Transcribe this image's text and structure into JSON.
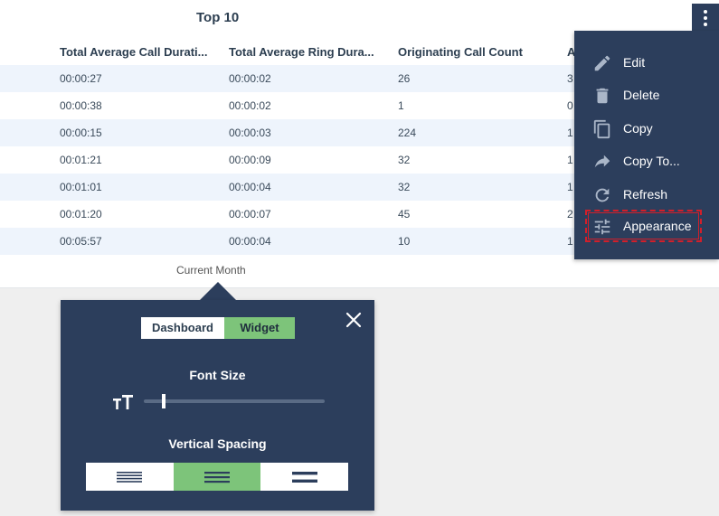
{
  "widget": {
    "title": "Top 10",
    "footer": "Current Month",
    "columns": [
      "Total Average Call Durati...",
      "Total Average Ring Dura...",
      "Originating Call Count",
      "A"
    ],
    "rows": [
      [
        "00:00:27",
        "00:00:02",
        "26",
        "3"
      ],
      [
        "00:00:38",
        "00:00:02",
        "1",
        "0"
      ],
      [
        "00:00:15",
        "00:00:03",
        "224",
        "1"
      ],
      [
        "00:01:21",
        "00:00:09",
        "32",
        "1"
      ],
      [
        "00:01:01",
        "00:00:04",
        "32",
        "1"
      ],
      [
        "00:01:20",
        "00:00:07",
        "45",
        "2"
      ],
      [
        "00:05:57",
        "00:00:04",
        "10",
        "1"
      ]
    ]
  },
  "menu": {
    "items": [
      {
        "label": "Edit",
        "icon": "pencil-icon"
      },
      {
        "label": "Delete",
        "icon": "trash-icon"
      },
      {
        "label": "Copy",
        "icon": "copy-icon"
      },
      {
        "label": "Copy To...",
        "icon": "share-arrow-icon"
      },
      {
        "label": "Refresh",
        "icon": "refresh-icon"
      },
      {
        "label": "Appearance",
        "icon": "sliders-icon"
      }
    ]
  },
  "appearance": {
    "tabs": [
      "Dashboard",
      "Widget"
    ],
    "active_tab": "Widget",
    "font_size_label": "Font Size",
    "font_size_level": 0.1,
    "vertical_spacing_label": "Vertical Spacing",
    "spacing_options": [
      "compact",
      "normal",
      "wide"
    ],
    "spacing_selected": "normal"
  },
  "colors": {
    "navy": "#2c3e5c",
    "green": "#7dc47a",
    "row_alt": "#eef4fc",
    "highlight": "#d21f2a"
  }
}
